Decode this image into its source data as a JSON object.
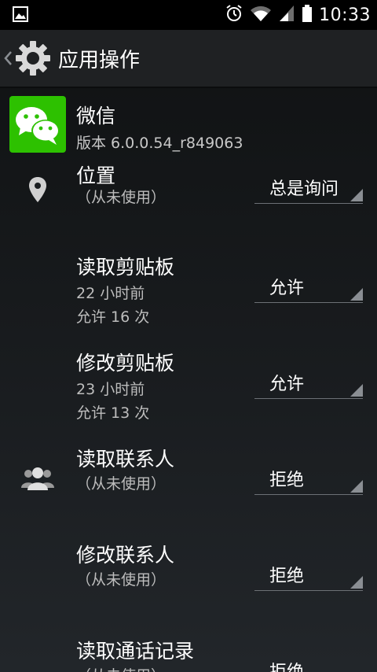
{
  "status_bar": {
    "time": "10:33",
    "icons": [
      "image-notification-icon",
      "alarm-icon",
      "wifi-icon",
      "cell-signal-icon",
      "battery-icon"
    ]
  },
  "action_bar": {
    "title": "应用操作",
    "back_icon": "chevron-left-icon",
    "app_icon": "gear-icon"
  },
  "app": {
    "name": "微信",
    "version": "版本 6.0.0.54_r849063",
    "icon": "wechat-logo",
    "brand_color": "#2dc100"
  },
  "permissions": [
    {
      "icon": "location-pin-icon",
      "title": "位置",
      "sub1": "（从未使用）",
      "sub2": "",
      "value": "总是询问"
    },
    {
      "icon": "",
      "title": "读取剪贴板",
      "sub1": "22 小时前",
      "sub2": "允许 16 次",
      "value": "允许"
    },
    {
      "icon": "",
      "title": "修改剪贴板",
      "sub1": "23 小时前",
      "sub2": "允许 13 次",
      "value": "允许"
    },
    {
      "icon": "contacts-icon",
      "title": "读取联系人",
      "sub1": "（从未使用）",
      "sub2": "",
      "value": "拒绝"
    },
    {
      "icon": "",
      "title": "修改联系人",
      "sub1": "（从未使用）",
      "sub2": "",
      "value": "拒绝"
    },
    {
      "icon": "",
      "title": "读取通话记录",
      "sub1": "（从未使用）",
      "sub2": "",
      "value": "拒绝"
    }
  ]
}
